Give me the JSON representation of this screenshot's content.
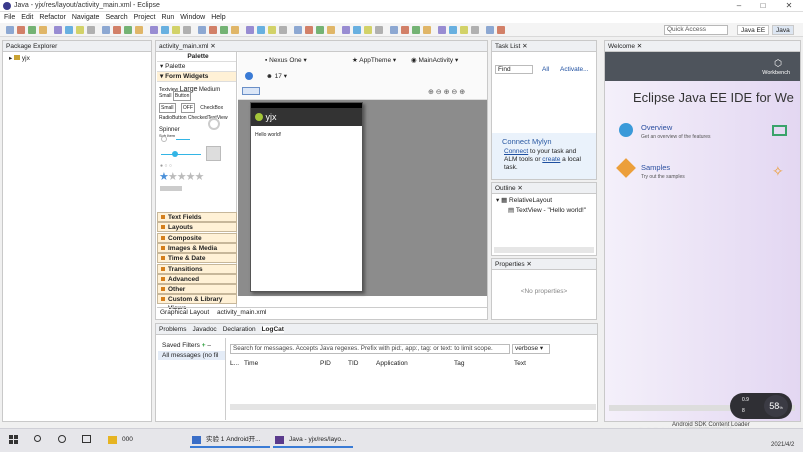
{
  "window": {
    "title": "Java - yjx/res/layout/activity_main.xml - Eclipse"
  },
  "menu": [
    "File",
    "Edit",
    "Refactor",
    "Navigate",
    "Search",
    "Project",
    "Run",
    "Window",
    "Help"
  ],
  "quick_access": "Quick Access",
  "perspectives": [
    "Java EE",
    "Java"
  ],
  "package_explorer": {
    "tab": "Package Explorer",
    "item": "yjx"
  },
  "editor": {
    "tab": "activity_main.xml",
    "palette_title": "Palette",
    "palette_dropdown": "Palette",
    "form_widgets": "Form Widgets",
    "widget_sizes": [
      "Textview",
      "Large",
      "Medium",
      "Small",
      "Button"
    ],
    "small_buttons": [
      "Small",
      "OFF",
      "CheckBox"
    ],
    "radio": "RadioButton CheckedTextView",
    "spinner": "Spinner",
    "spinner_sub": "Sub Item",
    "categories": [
      "Text Fields",
      "Layouts",
      "Composite",
      "Images & Media",
      "Time & Date",
      "Transitions",
      "Advanced",
      "Other",
      "Custom & Library Views"
    ],
    "device": "Nexus One",
    "theme": "AppTheme",
    "activity": "MainActivity",
    "api": "17",
    "app_name": "yjx",
    "hello": "Hello world!",
    "bottom_tabs": [
      "Graphical Layout",
      "activity_main.xml"
    ]
  },
  "task_list": {
    "tab": "Task List",
    "find": "Find",
    "all": "All",
    "activate": "Activate..."
  },
  "mylyn": {
    "title": "Connect Mylyn",
    "link1": "Connect",
    "text1": " to your task and",
    "text2": "ALM tools or ",
    "link2": "create",
    "text3": " a local",
    "text4": "task."
  },
  "outline": {
    "tab": "Outline",
    "root": "RelativeLayout",
    "child": "TextView - \"Hello world!\""
  },
  "properties": {
    "tab": "Properties",
    "empty": "<No properties>"
  },
  "welcome": {
    "tab": "Welcome",
    "workbench": "Workbench",
    "title": "Eclipse Java EE IDE for We",
    "overview": "Overview",
    "overview_desc": "Get an overview of the features",
    "samples": "Samples",
    "samples_desc": "Try out the samples"
  },
  "bottom": {
    "tabs": [
      "Problems",
      "Javadoc",
      "Declaration",
      "LogCat"
    ],
    "saved_filters": "Saved Filters",
    "all_messages": "All messages (no fil",
    "search_placeholder": "Search for messages. Accepts Java regexes. Prefix with pid:, app:, tag: or text: to limit scope.",
    "level": "verbose",
    "columns": [
      "L...",
      "Time",
      "PID",
      "TID",
      "Application",
      "Tag",
      "Text"
    ]
  },
  "status": {
    "loader": "Android SDK Content Loader",
    "watermark": "CSDN @阿轩同学",
    "date": "2021/4/2"
  },
  "overlay": {
    "percent": "58",
    "up": "0.9",
    "down": "8"
  },
  "taskbar": {
    "items": [
      "000",
      "实验 1 Android开...",
      "Java - yjx/res/layo..."
    ]
  }
}
